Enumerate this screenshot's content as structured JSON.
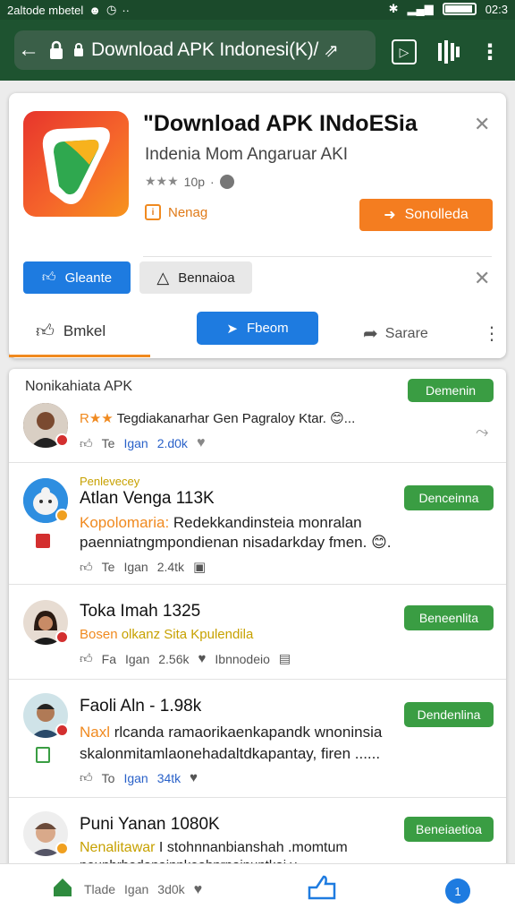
{
  "status_bar": {
    "left_text": "2altode mbetel",
    "time": "02:3"
  },
  "browser": {
    "url": "Download APK Indonesi(K)/"
  },
  "app": {
    "title": "\"Download APK INdoESia",
    "subtitle": "Indenia Mom Angaruar AKI",
    "rating": "10p",
    "tag": "Nenag",
    "primary_button": "Sonolleda",
    "chip_share": "Gleante",
    "chip_warning": "Bennaioa",
    "tabs": [
      "Bmkel",
      "Fbeom",
      "Sarare"
    ]
  },
  "comments_section": {
    "header": "Nonikahiata APK",
    "header_button": "Demenin",
    "top_comment": "Tegdiakanarhar Gen Pagraloy Ktar. 😊...",
    "top_stats": [
      "Te",
      "Igan",
      "2.d0k"
    ]
  },
  "comments": [
    {
      "tag": "Penlevecey",
      "name": "Atlan Venga 113K",
      "line1_prefix": "Kopolomaria:",
      "line1": " Redekkandinsteia monralan",
      "line2": "paenniatngmpondienan nisadarkday fmen. 😊...",
      "stats": [
        "Te",
        "Igan",
        "2.4tk"
      ],
      "button": "Denceinna"
    },
    {
      "name": "Toka Imah 1325",
      "line1_prefix": "Bosen",
      "line1": " olkanz Sita Kpulendila",
      "stats": [
        "Fa",
        "Igan",
        "2.56k",
        "Ibnnodeio"
      ],
      "button": "Beneenlita"
    },
    {
      "name": "Faoli Aln - 1.98k",
      "line1_prefix": "Naxl",
      "line1": " rlcanda ramaorikaenkapandk wnoninsia",
      "line2": "skalonmitamlaonehadaltdkapantay, firen ......",
      "stats": [
        "To",
        "Igan",
        "34tk"
      ],
      "button": "Dendenlina"
    },
    {
      "name": "Puni Yanan 1080K",
      "line1_prefix": "Nenalitawar",
      "line1": " I stohnnanbianshah .momtum",
      "line2": "neunhrhodanainnkeahnrnainuntkai y",
      "button": "Beneiaetioa"
    }
  ],
  "bottom_nav": {
    "stats": [
      "Tlade",
      "Igan",
      "3d0k"
    ],
    "notification_count": "1"
  }
}
